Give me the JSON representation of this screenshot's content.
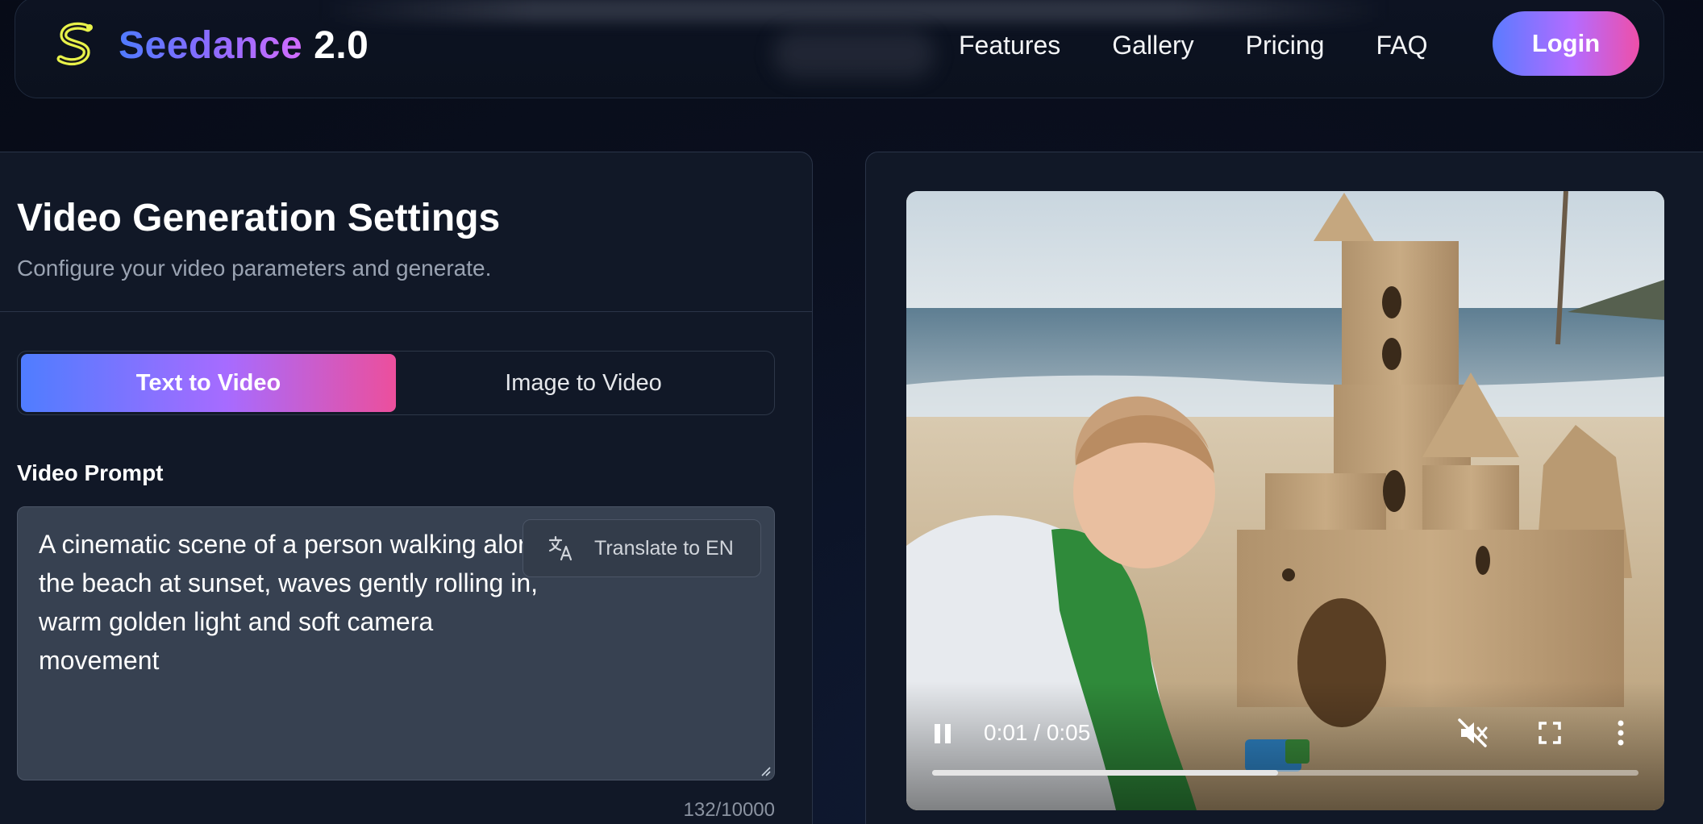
{
  "header": {
    "brand_name": "Seedance",
    "brand_version": "2.0",
    "logo_icon": "s-logo-icon",
    "nav": [
      "Features",
      "Gallery",
      "Pricing",
      "FAQ"
    ],
    "login_label": "Login"
  },
  "settings": {
    "title": "Video Generation Settings",
    "subtitle": "Configure your video parameters and generate.",
    "tabs": [
      {
        "label": "Text to Video",
        "active": true
      },
      {
        "label": "Image to Video",
        "active": false
      }
    ],
    "prompt_label": "Video Prompt",
    "prompt_value": "A cinematic scene of a person walking along\nthe beach at sunset, waves gently rolling in,\nwarm golden light and soft camera\nmovement",
    "translate_label": "Translate to EN",
    "translate_icon": "translate-icon",
    "char_count": "132/10000"
  },
  "video": {
    "time": "0:01 / 0:05",
    "progress": 0.49,
    "muted": true,
    "controls": [
      "pause-icon",
      "mute-icon",
      "fullscreen-icon",
      "more-vertical-icon"
    ]
  },
  "colors": {
    "accent_start": "#4f7dff",
    "accent_mid": "#a76bff",
    "accent_end": "#ec4f9c",
    "panel_bg": "#111827",
    "textarea_bg": "#374151"
  }
}
